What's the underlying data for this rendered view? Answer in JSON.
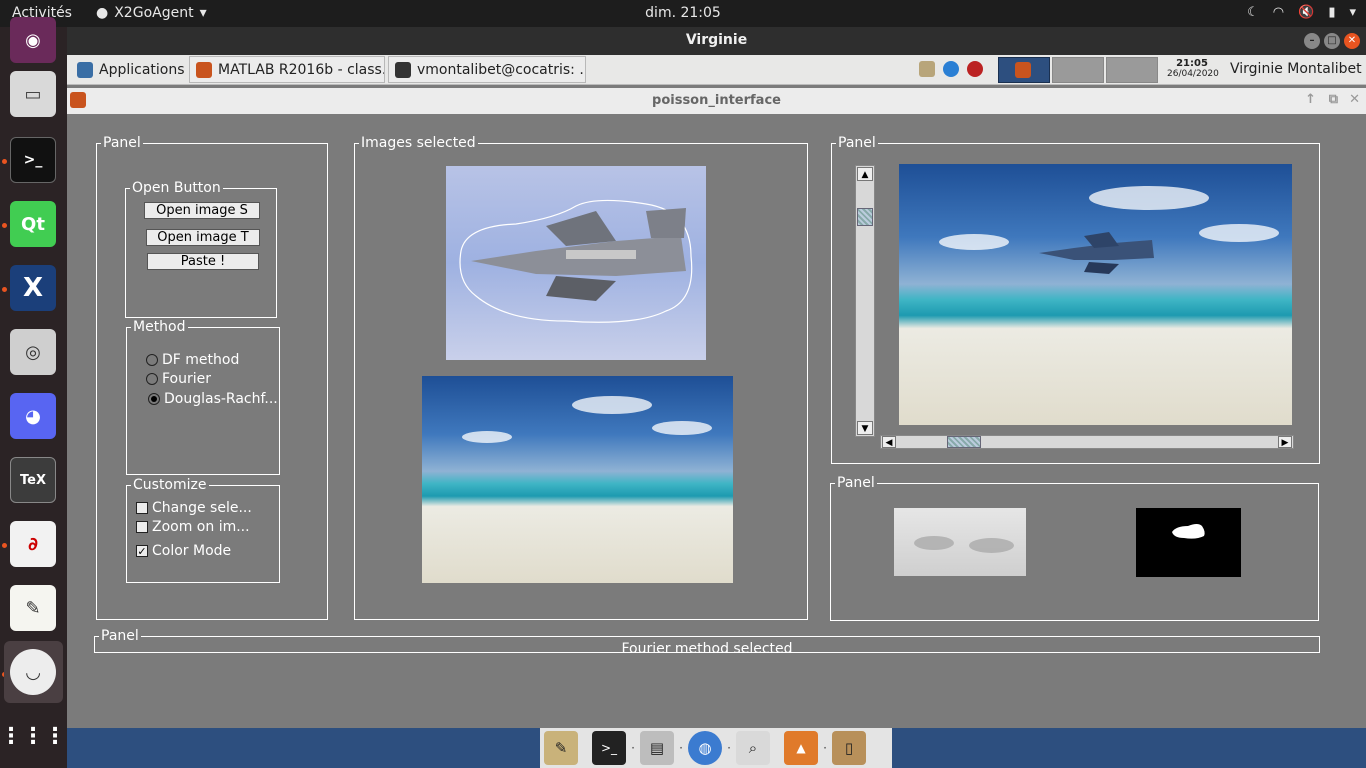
{
  "topbar": {
    "activities": "Activités",
    "app_name": "X2GoAgent",
    "clock": "dim. 21:05"
  },
  "remote_window": {
    "title": "Virginie"
  },
  "xfce_panel": {
    "applications": "Applications",
    "tasks": [
      "MATLAB R2016b - class...",
      "vmontalibet@cocatris: ..."
    ],
    "time": "21:05",
    "date": "26/04/2020",
    "user": "Virginie Montalibet"
  },
  "figure": {
    "title": "poisson_interface",
    "left_panel": {
      "label": "Panel",
      "open_group": {
        "label": "Open Button",
        "buttons": [
          "Open image S",
          "Open image T",
          "Paste !"
        ]
      },
      "method_group": {
        "label": "Method",
        "options": [
          "DF method",
          "Fourier",
          "Douglas-Rachf..."
        ],
        "selected": "Douglas-Rachf..."
      },
      "customize_group": {
        "label": "Customize",
        "checkboxes": [
          {
            "label": "Change sele...",
            "checked": false
          },
          {
            "label": "Zoom on im...",
            "checked": false
          },
          {
            "label": "Color Mode",
            "checked": true
          }
        ]
      }
    },
    "images_panel": {
      "label": "Images selected"
    },
    "preview_panel": {
      "label": "Panel"
    },
    "mask_panel": {
      "label": "Panel"
    },
    "status_panel": {
      "label": "Panel",
      "message": "Fourier method selected"
    }
  },
  "colors": {
    "figure_bg": "#7b7b7b",
    "ubuntu_accent": "#e95420",
    "topbar_bg": "#1d1d1d"
  },
  "icons": {
    "dock": [
      "firefox-icon",
      "files-icon",
      "terminal-icon",
      "qt-creator-icon",
      "x-icon",
      "camera-icon",
      "discord-icon",
      "texmaker-icon",
      "pdf-reader-icon",
      "text-editor-icon",
      "x2go-icon",
      "app-grid-icon"
    ],
    "bottom_dock": [
      "settings-icon",
      "terminal-icon",
      "file-manager-icon",
      "web-browser-icon",
      "search-icon",
      "matlab-icon",
      "notes-icon"
    ]
  }
}
